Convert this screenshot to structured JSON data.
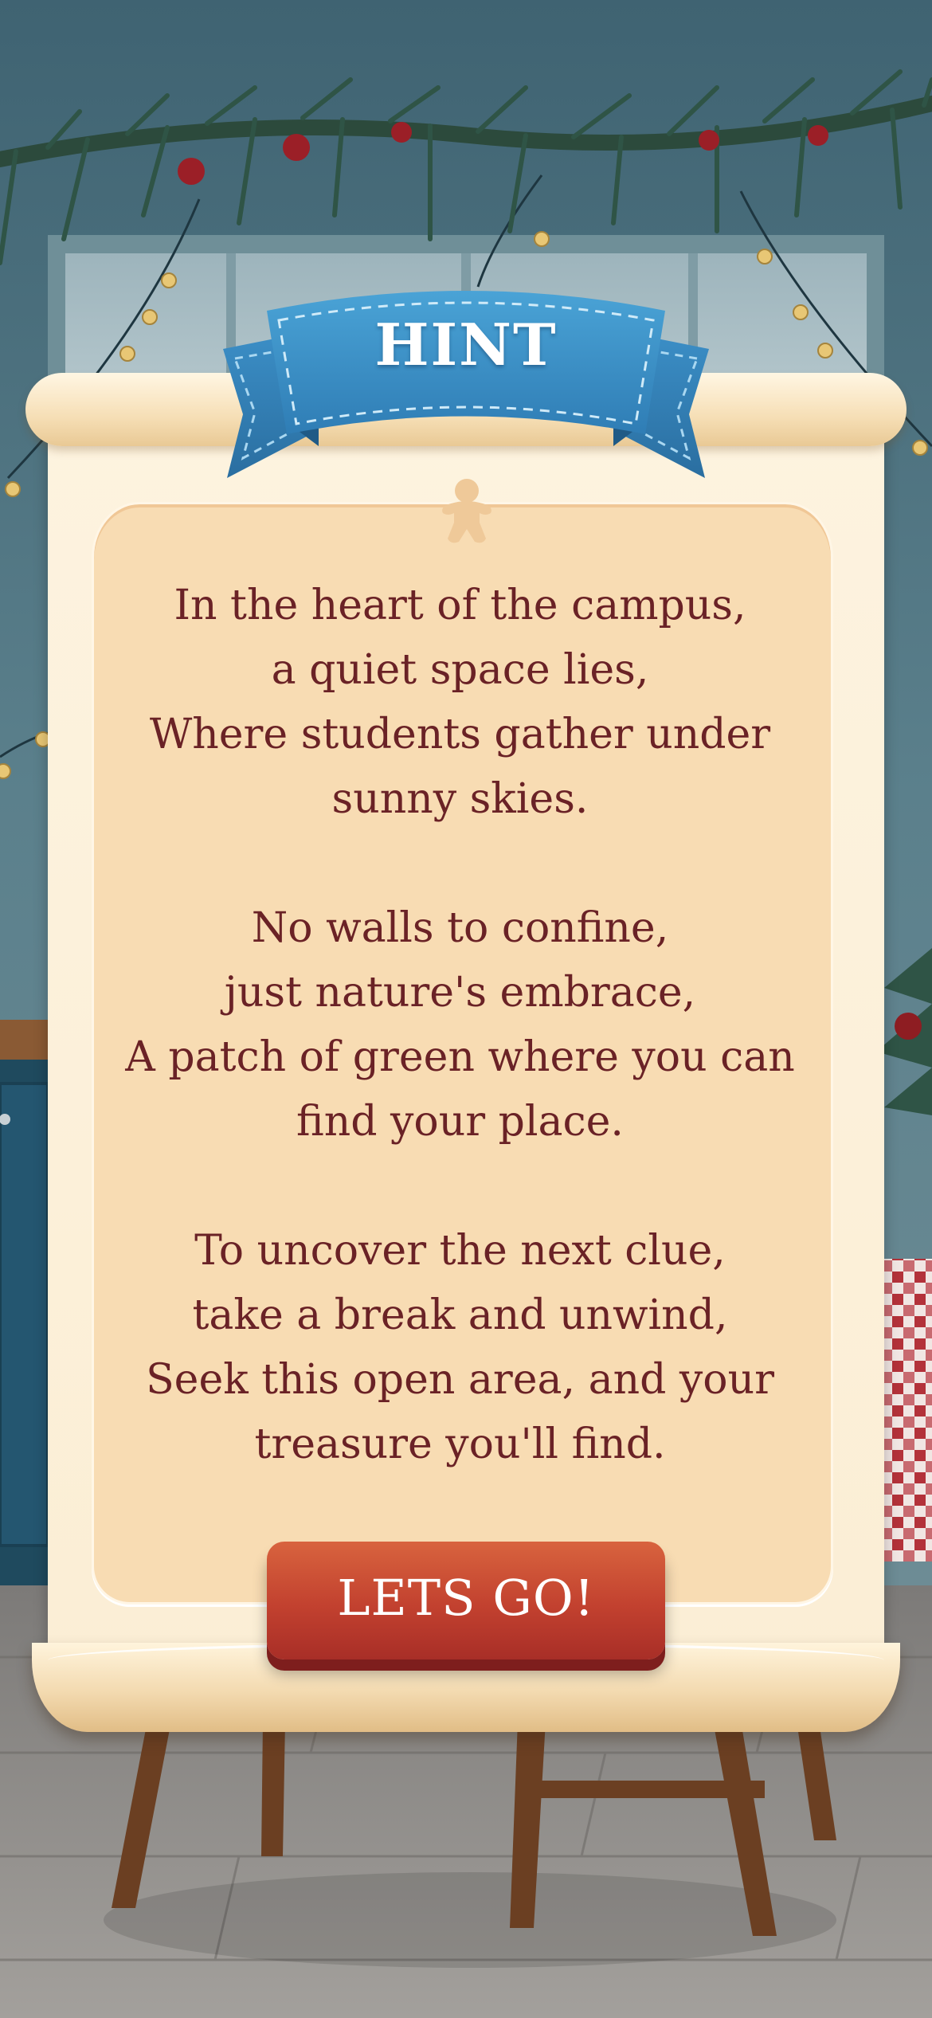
{
  "hint": {
    "title": "HINT",
    "stanzas": [
      [
        "In the heart of the campus,",
        "a quiet space lies,",
        "Where students gather under",
        "sunny skies."
      ],
      [
        "No walls to confine,",
        "just nature's embrace,",
        "A patch of green where you can",
        "find your place."
      ],
      [
        "To uncover the next clue,",
        "take a break and unwind,",
        "Seek this open area, and your",
        "treasure you'll find."
      ]
    ],
    "button_label": "LETS GO!"
  },
  "colors": {
    "poem_text": "#6a2226",
    "ribbon": "#3d8fc4",
    "button": "#c2412f",
    "panel": "#f8dcb3",
    "wall": "#5a7f8c"
  },
  "icons": [
    "gingerbread-icon",
    "ribbon-banner",
    "garland-decoration"
  ]
}
